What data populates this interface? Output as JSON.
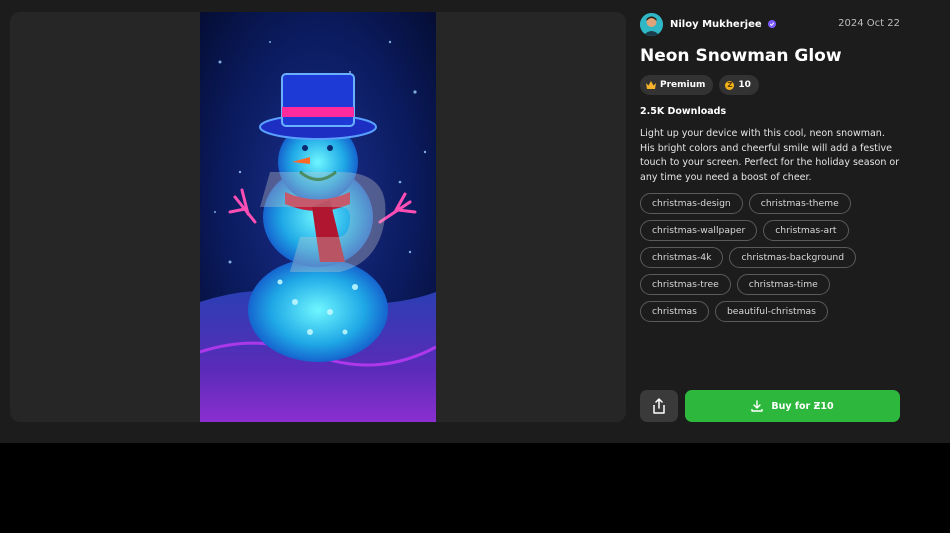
{
  "author": {
    "name": "Niloy Mukherjee",
    "verified_icon": "verified-badge-icon",
    "avatar_icon": "avatar"
  },
  "date": "2024 Oct 22",
  "title": "Neon Snowman Glow",
  "badges": {
    "premium_label": "Premium",
    "price_label": "10"
  },
  "downloads": "2.5K Downloads",
  "description": "Light up your device with this cool, neon snowman. His bright colors and cheerful smile will add a festive touch to your screen. Perfect for the holiday season or any time you need a boost of cheer.",
  "tags": [
    "christmas-design",
    "christmas-theme",
    "christmas-wallpaper",
    "christmas-art",
    "christmas-4k",
    "christmas-background",
    "christmas-tree",
    "christmas-time",
    "christmas",
    "beautiful-christmas"
  ],
  "actions": {
    "buy_label": "Buy for Ƶ10",
    "share_icon": "share-icon",
    "download_icon": "download-icon"
  },
  "colors": {
    "accent": "#2db83d",
    "background": "#1c1c1c",
    "panel": "#262626"
  }
}
